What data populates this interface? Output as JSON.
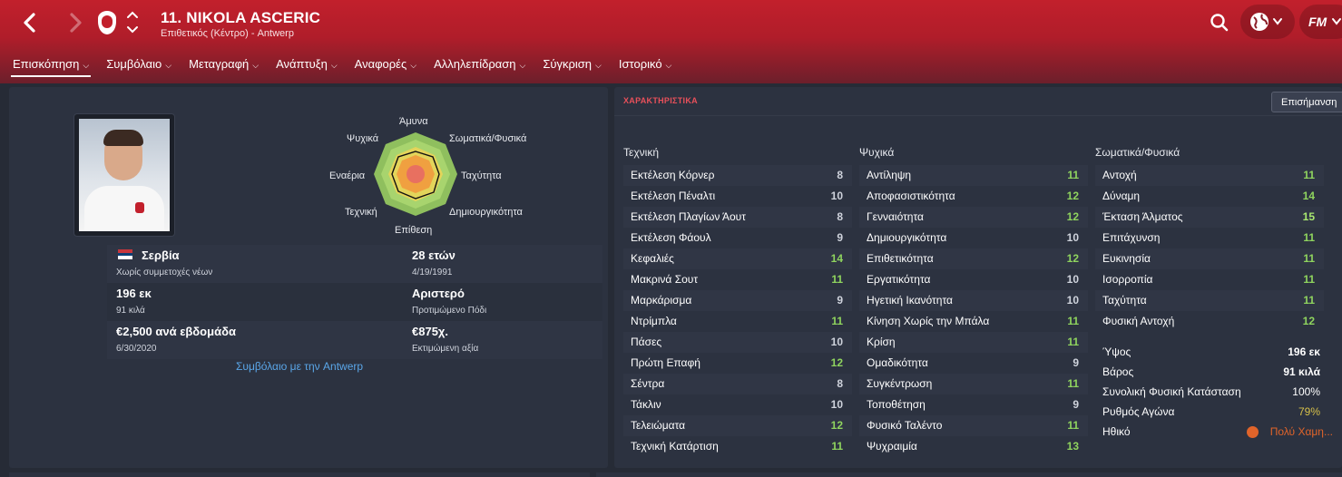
{
  "header": {
    "player_name": "11. NIKOLA ASCERIC",
    "player_sub": "Επιθετικός (Κέντρο) - Antwerp",
    "fm_label": "FM"
  },
  "tabs": [
    {
      "label": "Επισκόπηση"
    },
    {
      "label": "Συμβόλαιο"
    },
    {
      "label": "Μεταγραφή"
    },
    {
      "label": "Ανάπτυξη"
    },
    {
      "label": "Αναφορές"
    },
    {
      "label": "Αλληλεπίδραση"
    },
    {
      "label": "Σύγκριση"
    },
    {
      "label": "Ιστορικό"
    }
  ],
  "overview": {
    "nationality": "Σερβία",
    "youth_caps": "Χωρίς συμμετοχές νέων",
    "age": "28 ετών",
    "dob": "4/19/1991",
    "height": "196 εκ",
    "weight": "91 κιλά",
    "foot": "Αριστερό",
    "foot_label": "Προτιμώμενο Πόδι",
    "wage": "€2,500 ανά εβδομάδα",
    "contract_end": "6/30/2020",
    "value": "€875χ.",
    "value_label": "Εκτιμώμενη αξία",
    "contract_link": "Συμβόλαιο με την Antwerp"
  },
  "radar": {
    "labels": {
      "top": "Άμυνα",
      "top_right": "Σωματικά/Φυσικά",
      "right": "Ταχύτητα",
      "bottom_right": "Δημιουργικότητα",
      "bottom": "Επίθεση",
      "bottom_left": "Τεχνική",
      "left": "Εναέρια",
      "top_left": "Ψυχικά"
    }
  },
  "attributes": {
    "title": "ΧΑΡΑΚΤΗΡΙΣΤΙΚΑ",
    "highlight_button": "Επισήμανση",
    "technical_header": "Τεχνική",
    "mental_header": "Ψυχικά",
    "physical_header": "Σωματικά/Φυσικά",
    "technical": [
      {
        "name": "Εκτέλεση Κόρνερ",
        "value": "8"
      },
      {
        "name": "Εκτέλεση Πέναλτι",
        "value": "10"
      },
      {
        "name": "Εκτέλεση Πλαγίων Άουτ",
        "value": "8"
      },
      {
        "name": "Εκτέλεση Φάουλ",
        "value": "9"
      },
      {
        "name": "Κεφαλιές",
        "value": "14"
      },
      {
        "name": "Μακρινά Σουτ",
        "value": "11"
      },
      {
        "name": "Μαρκάρισμα",
        "value": "9"
      },
      {
        "name": "Ντρίμπλα",
        "value": "11"
      },
      {
        "name": "Πάσες",
        "value": "10"
      },
      {
        "name": "Πρώτη Επαφή",
        "value": "12"
      },
      {
        "name": "Σέντρα",
        "value": "8"
      },
      {
        "name": "Τάκλιν",
        "value": "10"
      },
      {
        "name": "Τελειώματα",
        "value": "12"
      },
      {
        "name": "Τεχνική Κατάρτιση",
        "value": "11"
      }
    ],
    "mental": [
      {
        "name": "Αντίληψη",
        "value": "11"
      },
      {
        "name": "Αποφασιστικότητα",
        "value": "12"
      },
      {
        "name": "Γενναιότητα",
        "value": "12"
      },
      {
        "name": "Δημιουργικότητα",
        "value": "10"
      },
      {
        "name": "Επιθετικότητα",
        "value": "12"
      },
      {
        "name": "Εργατικότητα",
        "value": "10"
      },
      {
        "name": "Ηγετική Ικανότητα",
        "value": "10"
      },
      {
        "name": "Κίνηση Χωρίς την Μπάλα",
        "value": "11"
      },
      {
        "name": "Κρίση",
        "value": "11"
      },
      {
        "name": "Ομαδικότητα",
        "value": "9"
      },
      {
        "name": "Συγκέντρωση",
        "value": "11"
      },
      {
        "name": "Τοποθέτηση",
        "value": "9"
      },
      {
        "name": "Φυσικό Ταλέντο",
        "value": "11"
      },
      {
        "name": "Ψυχραιμία",
        "value": "13"
      }
    ],
    "physical": [
      {
        "name": "Αντοχή",
        "value": "11"
      },
      {
        "name": "Δύναμη",
        "value": "14"
      },
      {
        "name": "Έκταση Άλματος",
        "value": "15"
      },
      {
        "name": "Επιτάχυνση",
        "value": "11"
      },
      {
        "name": "Ευκινησία",
        "value": "11"
      },
      {
        "name": "Ισορροπία",
        "value": "11"
      },
      {
        "name": "Ταχύτητα",
        "value": "11"
      },
      {
        "name": "Φυσική Αντοχή",
        "value": "12"
      }
    ],
    "physical_info": [
      {
        "name": "Ύψος",
        "value": "196 εκ"
      },
      {
        "name": "Βάρος",
        "value": "91 κιλά"
      },
      {
        "name": "Συνολική Φυσική Κατάσταση",
        "value": "100%"
      },
      {
        "name": "Ρυθμός Αγώνα",
        "value": "79%"
      },
      {
        "name": "Ηθικό",
        "value": "Πολύ Χαμη..."
      }
    ]
  },
  "colors": {
    "accent_red": "#c2202c",
    "value_green": "#8fd45e",
    "match_sharpness": "#d6c04a",
    "morale_orange": "#e0642a"
  }
}
